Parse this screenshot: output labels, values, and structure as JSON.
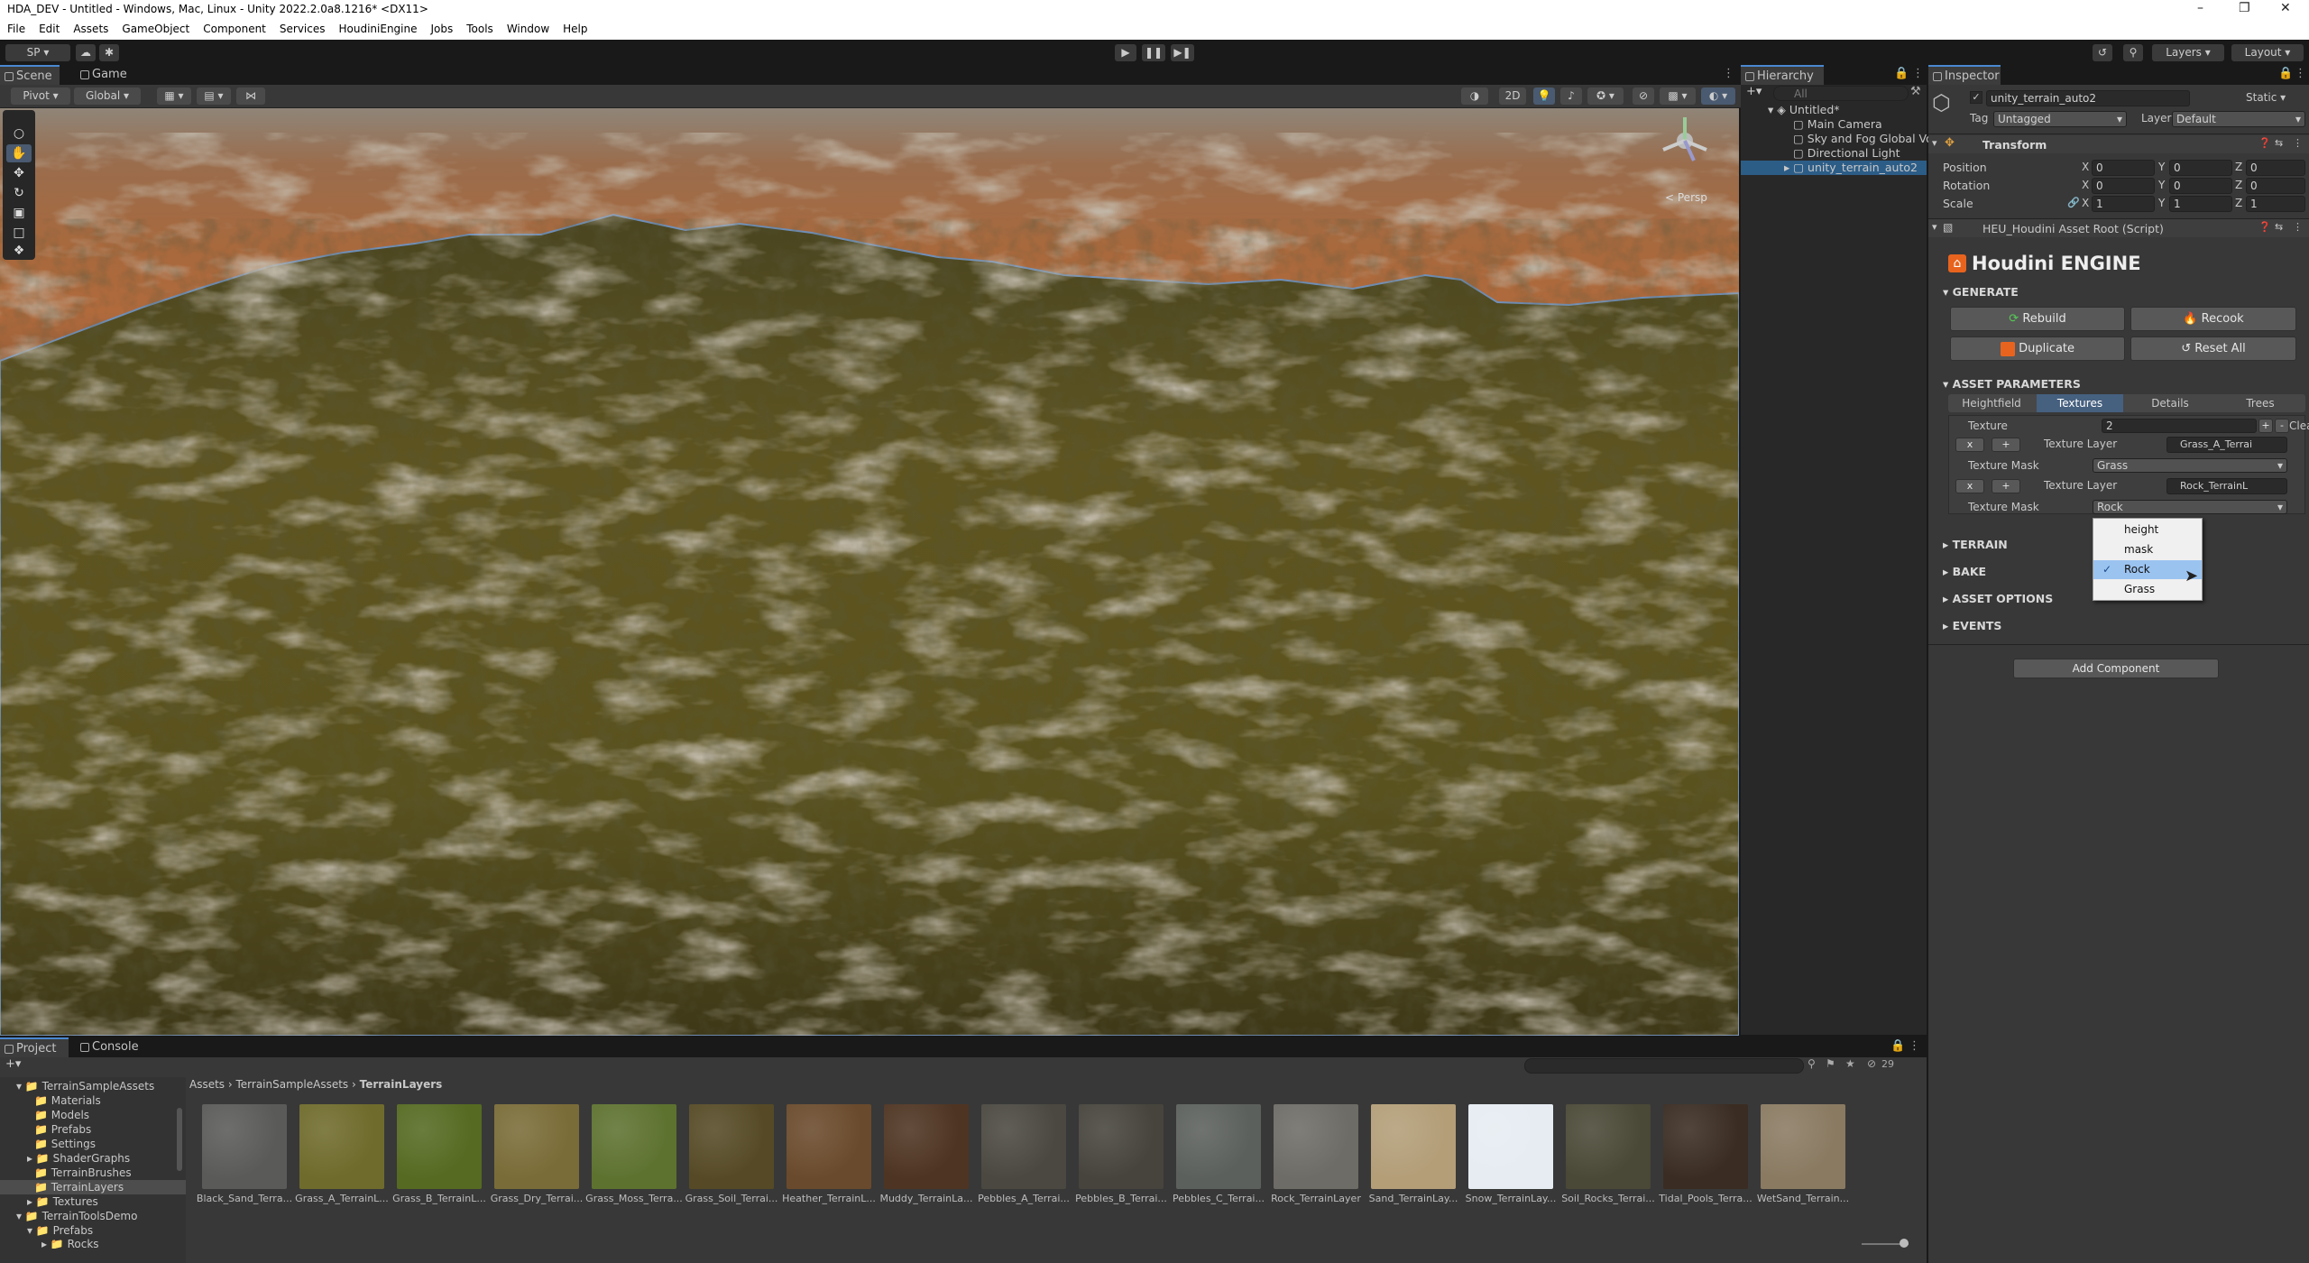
{
  "window": {
    "title": "HDA_DEV - Untitled - Windows, Mac, Linux - Unity 2022.2.0a8.1216* <DX11>"
  },
  "menu": [
    "File",
    "Edit",
    "Assets",
    "GameObject",
    "Component",
    "Services",
    "HoudiniEngine",
    "Jobs",
    "Tools",
    "Window",
    "Help"
  ],
  "toolbar": {
    "account": "SP",
    "layers": "Layers",
    "layout": "Layout"
  },
  "scene": {
    "tabs": [
      "Scene",
      "Game"
    ],
    "pivot": "Pivot",
    "global": "Global",
    "mode2d": "2D",
    "persp": "Persp"
  },
  "hierarchy": {
    "title": "Hierarchy",
    "search": "All",
    "root": "Untitled*",
    "items": [
      "Main Camera",
      "Sky and Fog Global Vo",
      "Directional Light",
      "unity_terrain_auto2"
    ]
  },
  "inspector": {
    "title": "Inspector",
    "object_name": "unity_terrain_auto2",
    "static": "Static",
    "tag_label": "Tag",
    "tag": "Untagged",
    "layer_label": "Layer",
    "layer": "Default",
    "transform": {
      "title": "Transform",
      "rows": [
        {
          "label": "Position",
          "x": "0",
          "y": "0",
          "z": "0"
        },
        {
          "label": "Rotation",
          "x": "0",
          "y": "0",
          "z": "0"
        },
        {
          "label": "Scale",
          "x": "1",
          "y": "1",
          "z": "1"
        }
      ]
    },
    "script": "HEU_Houdini Asset Root (Script)",
    "houdini": {
      "logo": "Houdini ENGINE",
      "generate": "GENERATE",
      "rebuild": "Rebuild",
      "recook": "Recook",
      "duplicate": "Duplicate",
      "reset_all": "Reset All",
      "asset_params": "ASSET PARAMETERS",
      "tabs": [
        "Heightfield",
        "Textures",
        "Details",
        "Trees"
      ],
      "texture_label": "Texture",
      "texture_count": "2",
      "clear": "Clear",
      "layer_label": "Texture Layer",
      "mask_label": "Texture Mask",
      "x": "x",
      "plus": "+",
      "layers": [
        {
          "asset": "Grass_A_Terrai",
          "mask": "Grass"
        },
        {
          "asset": "Rock_TerrainL",
          "mask": "Rock"
        }
      ],
      "sections": [
        "TERRAIN",
        "BAKE",
        "ASSET OPTIONS",
        "EVENTS"
      ]
    },
    "add_component": "Add Component",
    "dropdown": {
      "options": [
        "height",
        "mask",
        "Rock",
        "Grass"
      ],
      "selected": "Rock"
    }
  },
  "project": {
    "tabs": [
      "Project",
      "Console"
    ],
    "breadcrumb": [
      "Assets",
      "TerrainSampleAssets",
      "TerrainLayers"
    ],
    "visible_count": "29",
    "tree": [
      {
        "label": "TerrainSampleAssets",
        "level": 0
      },
      {
        "label": "Materials",
        "level": 1
      },
      {
        "label": "Models",
        "level": 1
      },
      {
        "label": "Prefabs",
        "level": 1
      },
      {
        "label": "Settings",
        "level": 1
      },
      {
        "label": "ShaderGraphs",
        "level": 1
      },
      {
        "label": "TerrainBrushes",
        "level": 1
      },
      {
        "label": "TerrainLayers",
        "level": 1
      },
      {
        "label": "Textures",
        "level": 1
      },
      {
        "label": "TerrainToolsDemo",
        "level": 0
      },
      {
        "label": "Prefabs",
        "level": 1
      },
      {
        "label": "Rocks",
        "level": 2
      }
    ],
    "assets": [
      {
        "name": "Black_Sand_Terra...",
        "color": "#5a5a58"
      },
      {
        "name": "Grass_A_TerrainL...",
        "color": "#6f6b2c"
      },
      {
        "name": "Grass_B_TerrainL...",
        "color": "#566a22"
      },
      {
        "name": "Grass_Dry_Terrai...",
        "color": "#7a6c38"
      },
      {
        "name": "Grass_Moss_Terra...",
        "color": "#5e7230"
      },
      {
        "name": "Grass_Soil_Terrai...",
        "color": "#564a26"
      },
      {
        "name": "Heather_TerrainL...",
        "color": "#6a4a2c"
      },
      {
        "name": "Muddy_TerrainLa...",
        "color": "#4e3422"
      },
      {
        "name": "Pebbles_A_Terrai...",
        "color": "#4a4840"
      },
      {
        "name": "Pebbles_B_Terrai...",
        "color": "#46443c"
      },
      {
        "name": "Pebbles_C_Terrai...",
        "color": "#5c605c"
      },
      {
        "name": "Rock_TerrainLayer",
        "color": "#6e6c66"
      },
      {
        "name": "Sand_TerrainLay...",
        "color": "#b39e78"
      },
      {
        "name": "Snow_TerrainLay...",
        "color": "#e6ecf2"
      },
      {
        "name": "Soil_Rocks_Terrai...",
        "color": "#4a4836"
      },
      {
        "name": "Tidal_Pools_Terra...",
        "color": "#3a2c22"
      },
      {
        "name": "WetSand_Terrain...",
        "color": "#8a7a62"
      }
    ]
  }
}
